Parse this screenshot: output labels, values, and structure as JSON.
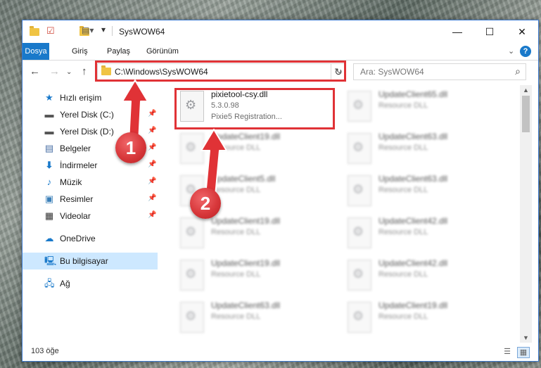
{
  "window": {
    "title": "SysWOW64",
    "controls": {
      "minimize": "—",
      "maximize": "☐",
      "close": "✕"
    }
  },
  "ribbon": {
    "tabs": [
      "Dosya",
      "Giriş",
      "Paylaş",
      "Görünüm"
    ],
    "help": "?"
  },
  "address_bar": {
    "path": "C:\\Windows\\SysWOW64"
  },
  "search": {
    "placeholder": "Ara: SysWOW64"
  },
  "sidebar": {
    "items": [
      {
        "label": "Hızlı erişim",
        "icon": "star-icon"
      },
      {
        "label": "Yerel Disk (C:)",
        "icon": "drive-icon"
      },
      {
        "label": "Yerel Disk (D:)",
        "icon": "drive-icon"
      },
      {
        "label": "Belgeler",
        "icon": "documents-icon"
      },
      {
        "label": "İndirmeler",
        "icon": "download-icon"
      },
      {
        "label": "Müzik",
        "icon": "music-icon"
      },
      {
        "label": "Resimler",
        "icon": "pictures-icon"
      },
      {
        "label": "Videolar",
        "icon": "video-icon"
      },
      {
        "label": "OneDrive",
        "icon": "cloud-icon"
      },
      {
        "label": "Bu bilgisayar",
        "icon": "computer-icon"
      },
      {
        "label": "Ağ",
        "icon": "network-icon"
      }
    ]
  },
  "files": [
    {
      "name": "pixietool-csy.dll",
      "line1": "5.3.0.98",
      "line2": "Pixie5 Registration..."
    },
    {
      "name": "UpdateClient65.dll",
      "line1": "Resource DLL"
    },
    {
      "name": "UpdateClient19.dll",
      "line1": "Resource DLL"
    },
    {
      "name": "UpdateClient63.dll",
      "line1": "Resource DLL"
    },
    {
      "name": "UpdateClient5.dll",
      "line1": "Resource DLL"
    },
    {
      "name": "UpdateClient63.dll",
      "line1": "Resource DLL"
    },
    {
      "name": "UpdateClient19.dll",
      "line1": "Resource DLL"
    },
    {
      "name": "UpdateClient42.dll",
      "line1": "Resource DLL"
    },
    {
      "name": "UpdateClient19.dll",
      "line1": "Resource DLL"
    },
    {
      "name": "UpdateClient42.dll",
      "line1": "Resource DLL"
    },
    {
      "name": "UpdateClient63.dll",
      "line1": "Resource DLL"
    },
    {
      "name": "UpdateClient19.dll",
      "line1": "Resource DLL"
    }
  ],
  "statusbar": {
    "item_count": "103 öğe"
  },
  "annotations": {
    "badge1": "1",
    "badge2": "2",
    "color": "#e03236"
  }
}
